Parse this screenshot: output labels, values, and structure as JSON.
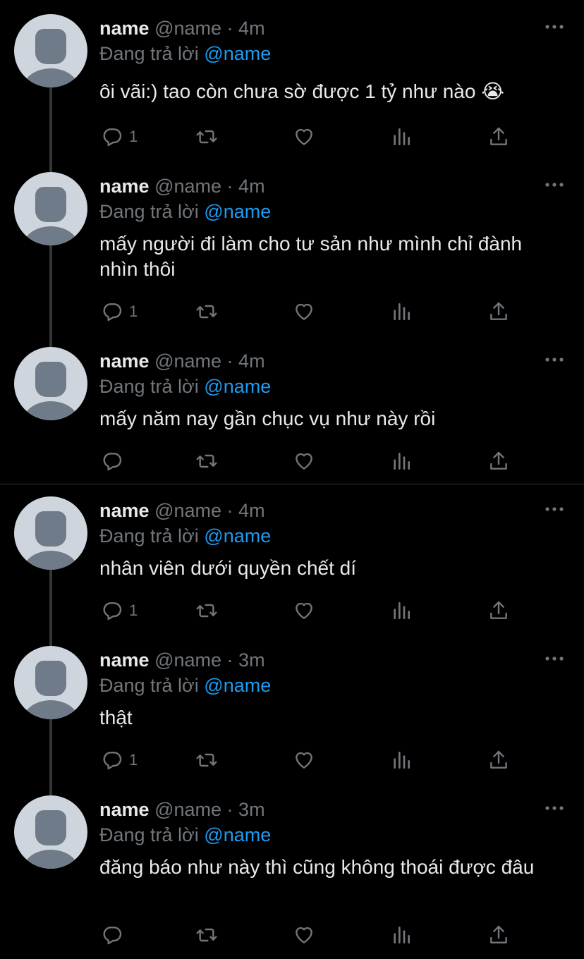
{
  "tweets": [
    {
      "name": "name",
      "handle": "@name",
      "sep": "·",
      "time": "4m",
      "reply_prefix": "Đang trả lời",
      "reply_to": "@name",
      "text": "ôi vãi:) tao còn chưa sờ được 1 tỷ như nào 😭",
      "reply_count": "1"
    },
    {
      "name": "name",
      "handle": "@name",
      "sep": "·",
      "time": "4m",
      "reply_prefix": "Đang trả lời",
      "reply_to": "@name",
      "text": "mấy người đi làm cho tư sản như mình chỉ đành nhìn thôi",
      "reply_count": "1"
    },
    {
      "name": "name",
      "handle": "@name",
      "sep": "·",
      "time": "4m",
      "reply_prefix": "Đang trả lời",
      "reply_to": "@name",
      "text": "mấy năm nay gần chục vụ như này rồi",
      "reply_count": ""
    },
    {
      "name": "name",
      "handle": "@name",
      "sep": "·",
      "time": "4m",
      "reply_prefix": "Đang trả lời",
      "reply_to": "@name",
      "text": "nhân viên dưới quyền chết dí",
      "reply_count": "1"
    },
    {
      "name": "name",
      "handle": "@name",
      "sep": "·",
      "time": "3m",
      "reply_prefix": "Đang trả lời",
      "reply_to": "@name",
      "text": "thật",
      "reply_count": "1"
    },
    {
      "name": "name",
      "handle": "@name",
      "sep": "·",
      "time": "3m",
      "reply_prefix": "Đang trả lời",
      "reply_to": "@name",
      "text": "đăng báo như này thì cũng không thoái được đâu",
      "reply_count": ""
    }
  ],
  "icons": {
    "reply": "reply-icon",
    "retweet": "retweet-icon",
    "like": "heart-icon",
    "views": "analytics-icon",
    "share": "share-icon",
    "more": "more-icon"
  },
  "colors": {
    "background": "#000000",
    "text": "#e7e9ea",
    "secondary": "#71767b",
    "accent": "#1d9bf0",
    "avatar_bg": "#ced5dc",
    "avatar_fg": "#6f7b88"
  }
}
